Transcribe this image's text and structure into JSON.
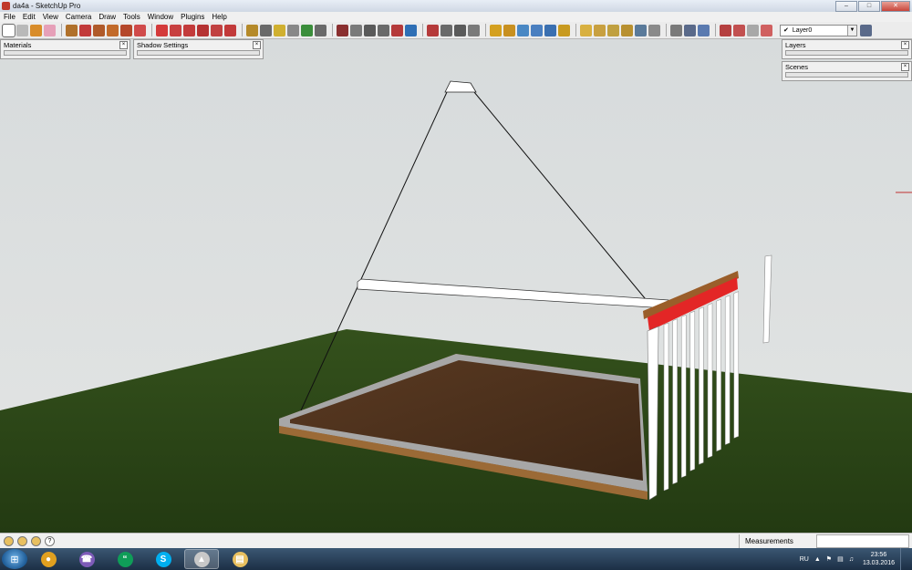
{
  "window": {
    "title": "da4a - SketchUp Pro",
    "minimize": "–",
    "maximize": "□",
    "close": "✕"
  },
  "menu": [
    "File",
    "Edit",
    "View",
    "Camera",
    "Draw",
    "Tools",
    "Window",
    "Plugins",
    "Help"
  ],
  "toolbar": {
    "tools": [
      {
        "name": "select-icon",
        "color": "#ffffff"
      },
      {
        "name": "make-component-icon",
        "color": "#b9b9b9"
      },
      {
        "name": "paint-bucket-icon",
        "color": "#d88c2a"
      },
      {
        "name": "eraser-icon",
        "color": "#e6a0b8"
      },
      {
        "name": "rectangle-icon",
        "color": "#b0702a"
      },
      {
        "name": "line-icon",
        "color": "#c23a3a"
      },
      {
        "name": "circle-icon",
        "color": "#b05a2a"
      },
      {
        "name": "arc-icon",
        "color": "#c26a2a"
      },
      {
        "name": "polygon-icon",
        "color": "#b5472a"
      },
      {
        "name": "freehand-icon",
        "color": "#d04a4a"
      },
      {
        "name": "move-icon",
        "color": "#d43a3a"
      },
      {
        "name": "push-pull-icon",
        "color": "#c84040"
      },
      {
        "name": "rotate-icon",
        "color": "#c33b3b"
      },
      {
        "name": "follow-me-icon",
        "color": "#b53232"
      },
      {
        "name": "scale-icon",
        "color": "#c14141"
      },
      {
        "name": "offset-icon",
        "color": "#c23a3a"
      },
      {
        "name": "tape-measure-icon",
        "color": "#b58a2a"
      },
      {
        "name": "dimension-icon",
        "color": "#6a6a6a"
      },
      {
        "name": "protractor-icon",
        "color": "#d0b030"
      },
      {
        "name": "text-icon",
        "color": "#888888"
      },
      {
        "name": "axes-icon",
        "color": "#3b8e3b"
      },
      {
        "name": "3d-text-icon",
        "color": "#6a6a6a"
      },
      {
        "name": "orbit-icon",
        "color": "#8a2f2f"
      },
      {
        "name": "pan-icon",
        "color": "#7a7a7a"
      },
      {
        "name": "zoom-icon",
        "color": "#5a5a5a"
      },
      {
        "name": "zoom-window-icon",
        "color": "#6a6a6a"
      },
      {
        "name": "zoom-extents-icon",
        "color": "#b53a3a"
      },
      {
        "name": "previous-view-icon",
        "color": "#2f6fb5"
      },
      {
        "name": "position-camera-icon",
        "color": "#b53a3a"
      },
      {
        "name": "look-around-icon",
        "color": "#6a6a6a"
      },
      {
        "name": "walk-icon",
        "color": "#5a5a5a"
      },
      {
        "name": "section-plane-icon",
        "color": "#7a7a7a"
      },
      {
        "name": "iso-view-icon",
        "color": "#d4a020"
      },
      {
        "name": "top-view-icon",
        "color": "#c89020"
      },
      {
        "name": "front-view-icon",
        "color": "#4a88c4"
      },
      {
        "name": "right-view-icon",
        "color": "#4a7fc0"
      },
      {
        "name": "back-view-icon",
        "color": "#3a6fb0"
      },
      {
        "name": "left-view-icon",
        "color": "#c89a20"
      },
      {
        "name": "xray-icon",
        "color": "#d8b040"
      },
      {
        "name": "wireframe-icon",
        "color": "#c8a040"
      },
      {
        "name": "hidden-line-icon",
        "color": "#c0a040"
      },
      {
        "name": "shaded-icon",
        "color": "#b89030"
      },
      {
        "name": "shaded-textures-icon",
        "color": "#5a7a9a"
      },
      {
        "name": "monochrome-icon",
        "color": "#8a8a8a"
      },
      {
        "name": "perspective-icon",
        "color": "#7a7a7a"
      },
      {
        "name": "views-parallel-icon",
        "color": "#5a6a8a"
      },
      {
        "name": "views-toggle-icon",
        "color": "#5a7ab0"
      },
      {
        "name": "warehouse-icon",
        "color": "#b54040"
      },
      {
        "name": "share-model-icon",
        "color": "#c25050"
      },
      {
        "name": "extension-icon",
        "color": "#a8a8a8"
      },
      {
        "name": "components-icon",
        "color": "#d06060"
      }
    ],
    "layer": "Layer0",
    "layer_check": "✔",
    "layer_dropdown": "▼"
  },
  "panels": {
    "materials": "Materials",
    "shadow_settings": "Shadow Settings",
    "layers": "Layers",
    "scenes": "Scenes",
    "close": "×"
  },
  "status": {
    "measurements_label": "Measurements",
    "help": "?"
  },
  "taskbar": {
    "start": "⊞",
    "apps": [
      {
        "name": "chrome-icon",
        "color": "#e0a020",
        "glyph": "●"
      },
      {
        "name": "viber-icon",
        "color": "#7d5bb8",
        "glyph": "☎"
      },
      {
        "name": "hangouts-icon",
        "color": "#0f9d58",
        "glyph": "“"
      },
      {
        "name": "skype-icon",
        "color": "#00aff0",
        "glyph": "S"
      },
      {
        "name": "sketchup-icon",
        "color": "#c8c8c8",
        "glyph": "▲"
      },
      {
        "name": "file-explorer-icon",
        "color": "#e8c060",
        "glyph": "▤"
      }
    ],
    "lang": "RU",
    "time": "23:56",
    "date": "13.03.2016"
  }
}
